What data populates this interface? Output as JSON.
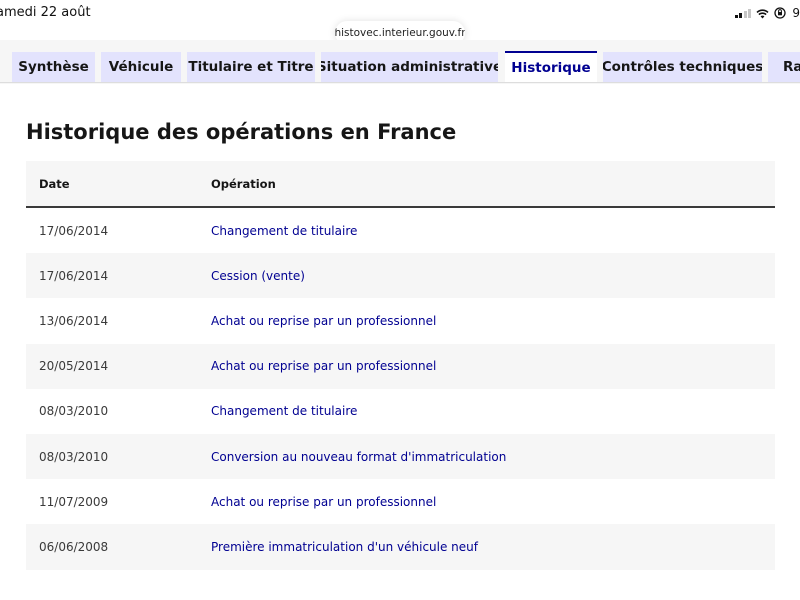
{
  "status_bar": {
    "time": "amedi 22 août",
    "battery": "9"
  },
  "browser": {
    "url": "histovec.interieur.gouv.fr"
  },
  "tabs": [
    {
      "label": "Synthèse",
      "active": false
    },
    {
      "label": "Véhicule",
      "active": false
    },
    {
      "label": "Titulaire et Titre",
      "active": false
    },
    {
      "label": "Situation administrative",
      "active": false
    },
    {
      "label": "Historique",
      "active": true
    },
    {
      "label": "Contrôles techniques",
      "active": false
    },
    {
      "label": "Rap",
      "active": false
    }
  ],
  "history": {
    "title": "Historique des opérations en France",
    "headers": {
      "date": "Date",
      "operation": "Opération"
    },
    "rows": [
      {
        "date": "17/06/2014",
        "operation": "Changement de titulaire"
      },
      {
        "date": "17/06/2014",
        "operation": "Cession (vente)"
      },
      {
        "date": "13/06/2014",
        "operation": "Achat ou reprise par un professionnel"
      },
      {
        "date": "20/05/2014",
        "operation": "Achat ou reprise par un professionnel"
      },
      {
        "date": "08/03/2010",
        "operation": "Changement de titulaire"
      },
      {
        "date": "08/03/2010",
        "operation": "Conversion au nouveau format d'immatriculation"
      },
      {
        "date": "11/07/2009",
        "operation": "Achat ou reprise par un professionnel"
      },
      {
        "date": "06/06/2008",
        "operation": "Première immatriculation d'un véhicule neuf"
      }
    ]
  },
  "colors": {
    "accent": "#000091",
    "tab_bg": "#e3e3fd",
    "stripe": "#f6f6f6"
  },
  "icons": [
    "signal-icon",
    "wifi-icon",
    "orientation-lock-icon"
  ]
}
